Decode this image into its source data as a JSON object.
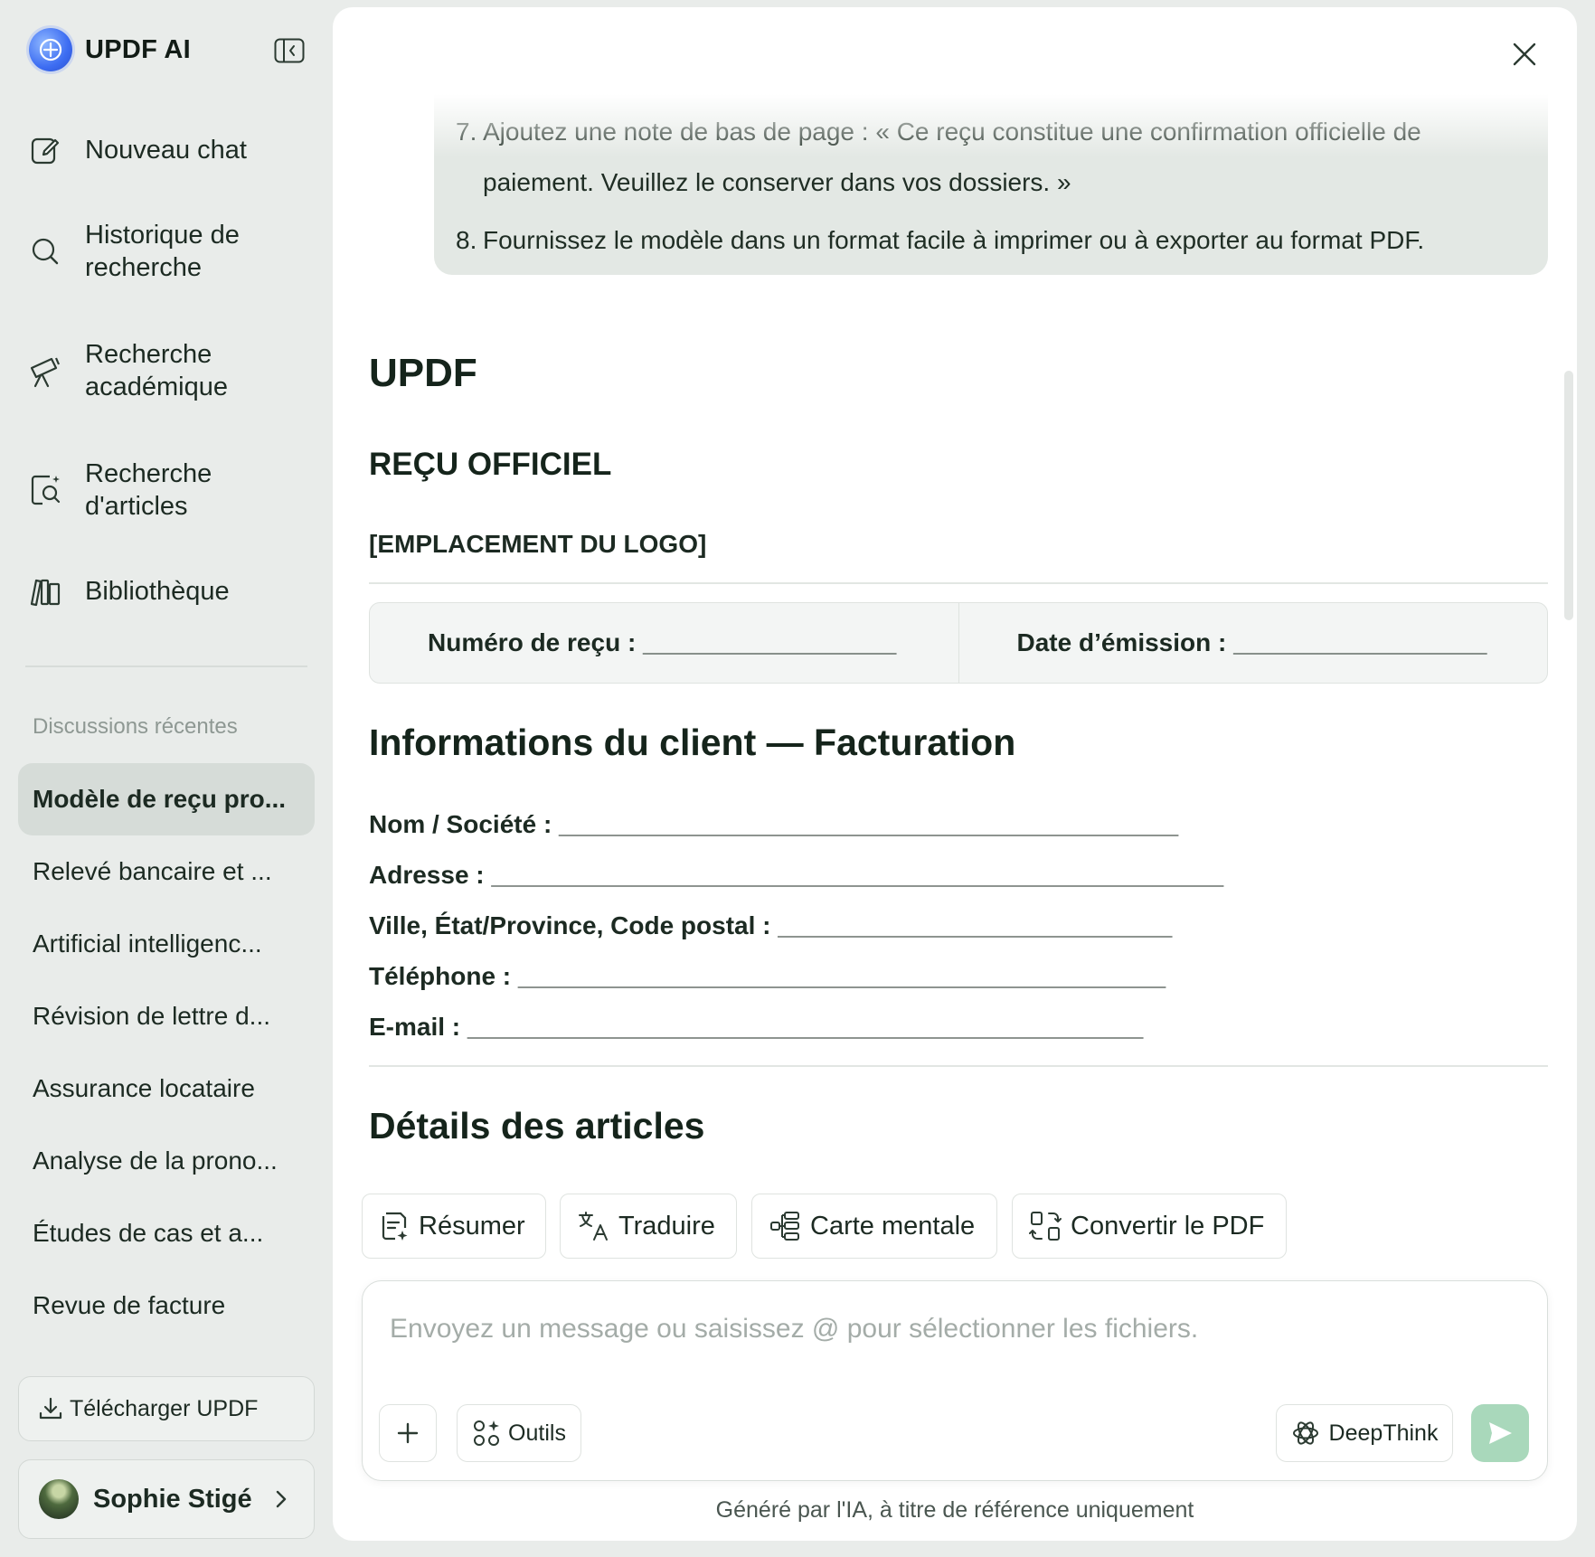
{
  "app": {
    "name": "UPDF AI"
  },
  "nav": [
    {
      "id": "new-chat",
      "label": "Nouveau chat",
      "icon": "edit-icon"
    },
    {
      "id": "search-history",
      "label": "Historique de recherche",
      "icon": "search-icon"
    },
    {
      "id": "academic-search",
      "label": "Recherche académique",
      "icon": "telescope-icon"
    },
    {
      "id": "article-search",
      "label": "Recherche d'articles",
      "icon": "document-search-icon"
    },
    {
      "id": "library",
      "label": "Bibliothèque",
      "icon": "library-icon"
    }
  ],
  "recent": {
    "title": "Discussions récentes",
    "items": [
      {
        "label": "Modèle de reçu pro...",
        "active": true
      },
      {
        "label": "Relevé bancaire et ...",
        "active": false
      },
      {
        "label": "Artificial intelligenc...",
        "active": false
      },
      {
        "label": "Révision de lettre d...",
        "active": false
      },
      {
        "label": "Assurance locataire",
        "active": false
      },
      {
        "label": "Analyse de la prono...",
        "active": false
      },
      {
        "label": "Études de cas et a...",
        "active": false
      },
      {
        "label": "Revue de facture",
        "active": false
      }
    ]
  },
  "download_label": "Télécharger UPDF",
  "user": {
    "name": "Sophie Stigé"
  },
  "user_message": {
    "items": [
      {
        "num": "7.",
        "text": "Ajoutez une note de bas de page : « Ce reçu constitue une confirmation officielle de paiement. Veuillez le conserver dans vos dossiers. »"
      },
      {
        "num": "8.",
        "text": "Fournissez le modèle dans un format facile à imprimer ou à exporter au format PDF."
      }
    ]
  },
  "document": {
    "brand": "UPDF",
    "title": "REÇU OFFICIEL",
    "logo_placeholder": "[EMPLACEMENT DU LOGO]",
    "receipt_number": "Numéro de reçu : __________________",
    "issue_date": "Date d’émission : __________________",
    "client_heading": "Informations du client — Facturation",
    "fields": [
      "Nom / Société : ____________________________________________",
      "Adresse : ____________________________________________________",
      "Ville, État/Province, Code postal : ____________________________",
      "Téléphone : ______________________________________________",
      "E-mail : ________________________________________________"
    ],
    "details_heading": "Détails des articles"
  },
  "tools": [
    {
      "label": "Résumer",
      "icon": "summarize-icon"
    },
    {
      "label": "Traduire",
      "icon": "translate-icon"
    },
    {
      "label": "Carte mentale",
      "icon": "mindmap-icon"
    },
    {
      "label": "Convertir le PDF",
      "icon": "convert-icon"
    }
  ],
  "composer": {
    "placeholder": "Envoyez un message ou saisissez @ pour sélectionner les fichiers.",
    "tools_label": "Outils",
    "deepthink_label": "DeepThink"
  },
  "footer_note": "Généré par l'IA, à titre de référence uniquement",
  "colors": {
    "accent": "#a9d8bb",
    "sidebar_bg": "#e9ecea",
    "active_item": "#d6dcd8"
  }
}
